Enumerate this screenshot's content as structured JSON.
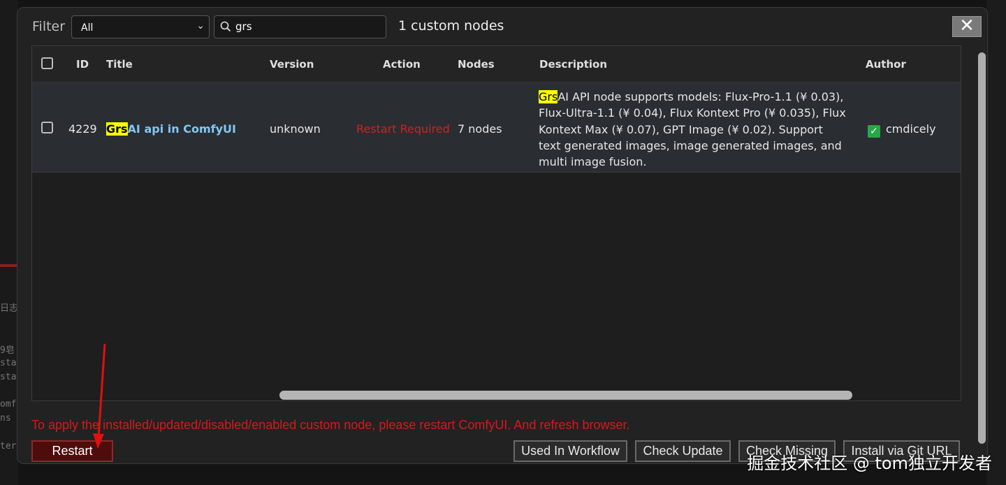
{
  "background": {
    "left_fragments": [
      "日志",
      "9皂|",
      "sta",
      "sta",
      "omf",
      "ns",
      "ter"
    ]
  },
  "header": {
    "filter_label": "Filter",
    "filter_value": "All",
    "search_value": "grs",
    "count_text": "1 custom nodes",
    "close_label": "✕"
  },
  "table": {
    "columns": [
      "ID",
      "Title",
      "Version",
      "Action",
      "Nodes",
      "Description",
      "Author"
    ],
    "rows": [
      {
        "id": "4229",
        "title_highlight": "Grs",
        "title_rest": "AI api in ComfyUI",
        "version": "unknown",
        "action": "Restart Required",
        "nodes": "7 nodes",
        "desc_highlight": "Grs",
        "desc_rest": "AI API node supports models: Flux-Pro-1.1 (¥ 0.03), Flux-Ultra-1.1 (¥ 0.04), Flux Kontext Pro (¥ 0.035), Flux Kontext Max (¥ 0.07), GPT Image (¥ 0.02). Support text generated images, image generated images, and multi image fusion.",
        "author": "cmdicely"
      }
    ]
  },
  "footer": {
    "notice": "To apply the installed/updated/disabled/enabled custom node, please restart ComfyUI. And refresh browser.",
    "restart_label": "Restart",
    "buttons": [
      "Used In Workflow",
      "Check Update",
      "Check Missing",
      "Install via Git URL"
    ]
  },
  "watermark": "掘金技术社区 @ tom独立开发者",
  "colors": {
    "highlight": "#ffff00",
    "action_red": "#d02020",
    "title_link": "#7fc8f5",
    "restart_bg": "#4f0c0c",
    "annotation_arrow": "#e01010"
  }
}
